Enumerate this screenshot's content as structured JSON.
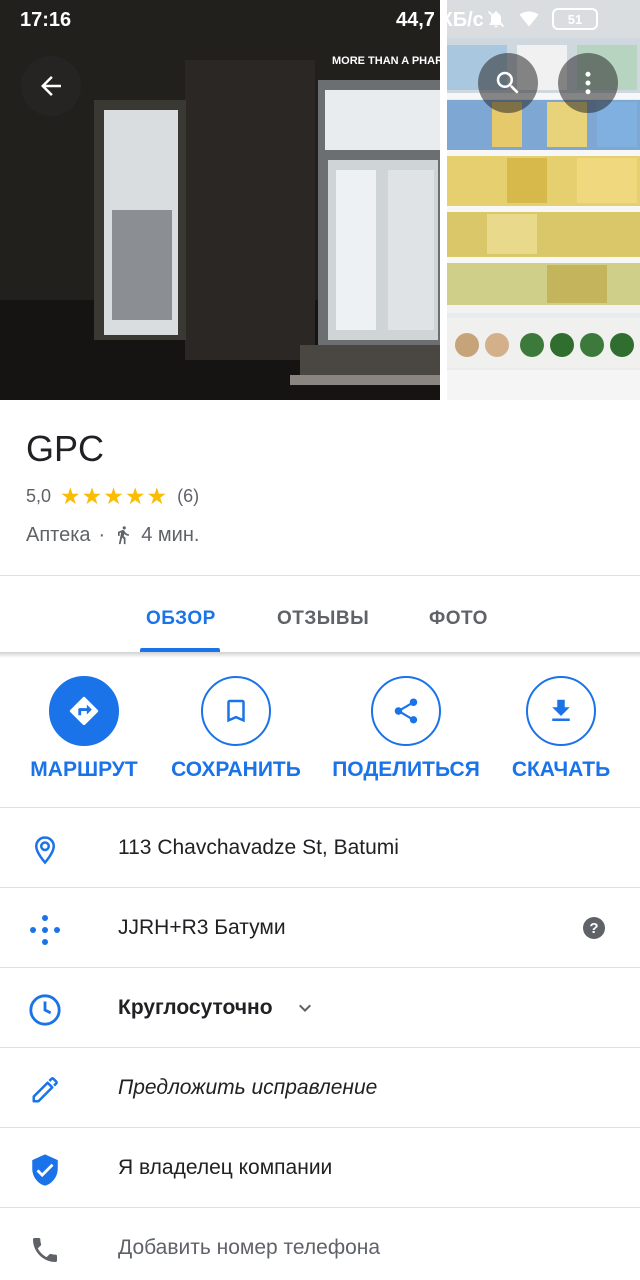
{
  "status_bar": {
    "time": "17:16",
    "speed": "44,7 КБ/с",
    "battery": "51"
  },
  "header": {
    "store_sign": "MORE THAN A PHARMA"
  },
  "place": {
    "name": "GPC",
    "rating": "5,0",
    "stars": "★★★★★",
    "reviews_count": "(6)",
    "category": "Аптека",
    "separator": "·",
    "walk_time": "4 мин."
  },
  "tabs": [
    {
      "label": "ОБЗОР",
      "active": true
    },
    {
      "label": "ОТЗЫВЫ",
      "active": false
    },
    {
      "label": "ФОТО",
      "active": false
    }
  ],
  "actions": [
    {
      "label": "МАРШРУТ",
      "icon": "directions-icon"
    },
    {
      "label": "СОХРАНИТЬ",
      "icon": "bookmark-icon"
    },
    {
      "label": "ПОДЕЛИТЬСЯ",
      "icon": "share-icon"
    },
    {
      "label": "СКАЧАТЬ",
      "icon": "download-icon"
    }
  ],
  "info": {
    "address": "113 Chavchavadze St, Batumi",
    "plus_code": "JJRH+R3 Батуми",
    "hours": "Круглосуточно",
    "suggest_edit": "Предложить исправление",
    "own_business": "Я владелец компании",
    "add_phone": "Добавить номер телефона"
  },
  "colors": {
    "accent": "#1a73e8",
    "star": "#fbbc04",
    "text_primary": "#202124",
    "text_secondary": "#5f6368"
  }
}
